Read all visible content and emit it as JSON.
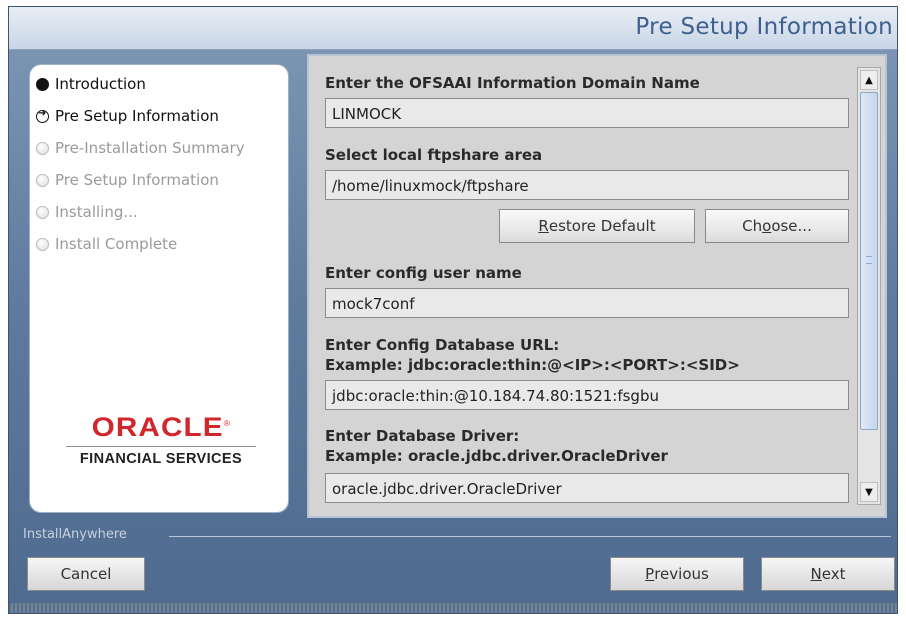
{
  "window": {
    "title": "Pre Setup Information"
  },
  "steps": [
    {
      "label": "Introduction",
      "state": "done"
    },
    {
      "label": "Pre Setup Information",
      "state": "current"
    },
    {
      "label": "Pre-Installation Summary",
      "state": "pending"
    },
    {
      "label": "Pre Setup Information",
      "state": "pending"
    },
    {
      "label": "Installing...",
      "state": "pending"
    },
    {
      "label": "Install Complete",
      "state": "pending"
    }
  ],
  "logo": {
    "brand": "ORACLE",
    "trademark": "®",
    "subtitle": "FINANCIAL SERVICES"
  },
  "form": {
    "info_domain": {
      "label": "Enter the OFSAAI Information Domain Name",
      "value": "LINMOCK"
    },
    "ftpshare": {
      "label": "Select local ftpshare area",
      "value": "/home/linuxmock/ftpshare",
      "restore_prefix": "",
      "restore_mnemonic": "R",
      "restore_suffix": "estore Default",
      "choose_prefix": "Ch",
      "choose_mnemonic": "o",
      "choose_suffix": "ose..."
    },
    "config_user": {
      "label": "Enter config user name",
      "value": "mock7conf"
    },
    "config_db_url": {
      "label": "Enter Config Database URL:",
      "example": "Example: jdbc:oracle:thin:@<IP>:<PORT>:<SID>",
      "value": "jdbc:oracle:thin:@10.184.74.80:1521:fsgbu"
    },
    "db_driver": {
      "label": "Enter Database Driver:",
      "example": "Example: oracle.jdbc.driver.OracleDriver",
      "value": "oracle.jdbc.driver.OracleDriver"
    }
  },
  "footer": {
    "brand_label": "InstallAnywhere",
    "cancel_label": "Cancel",
    "previous_mnemonic": "P",
    "previous_suffix": "revious",
    "next_mnemonic": "N",
    "next_suffix": "ext"
  },
  "icons": {
    "scroll_up": "scroll-up-arrow-icon",
    "scroll_down": "scroll-down-arrow-icon",
    "step_done": "filled-circle-icon",
    "step_current": "arrow-circle-icon",
    "step_pending": "empty-circle-icon"
  },
  "colors": {
    "title_text": "#3e5f8f",
    "oracle_red": "#d0272c",
    "window_bg": "#5e7a9d"
  }
}
